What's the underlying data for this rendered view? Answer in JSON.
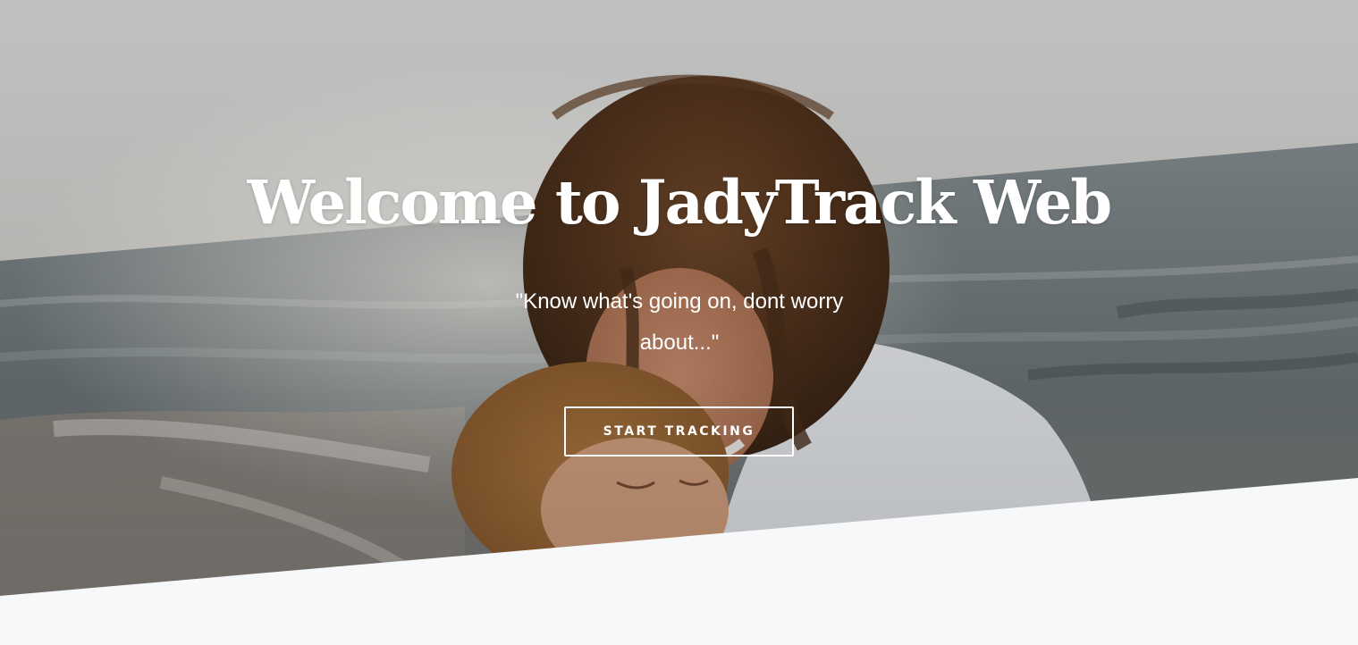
{
  "hero": {
    "title": "Welcome to JadyTrack Web",
    "tagline": "\"Know what's going on, dont worry about...\"",
    "cta_label": "START TRACKING",
    "image_subject": "mother-and-child-at-beach"
  },
  "colors": {
    "text": "#ffffff",
    "section_background": "#f7f8fa"
  }
}
